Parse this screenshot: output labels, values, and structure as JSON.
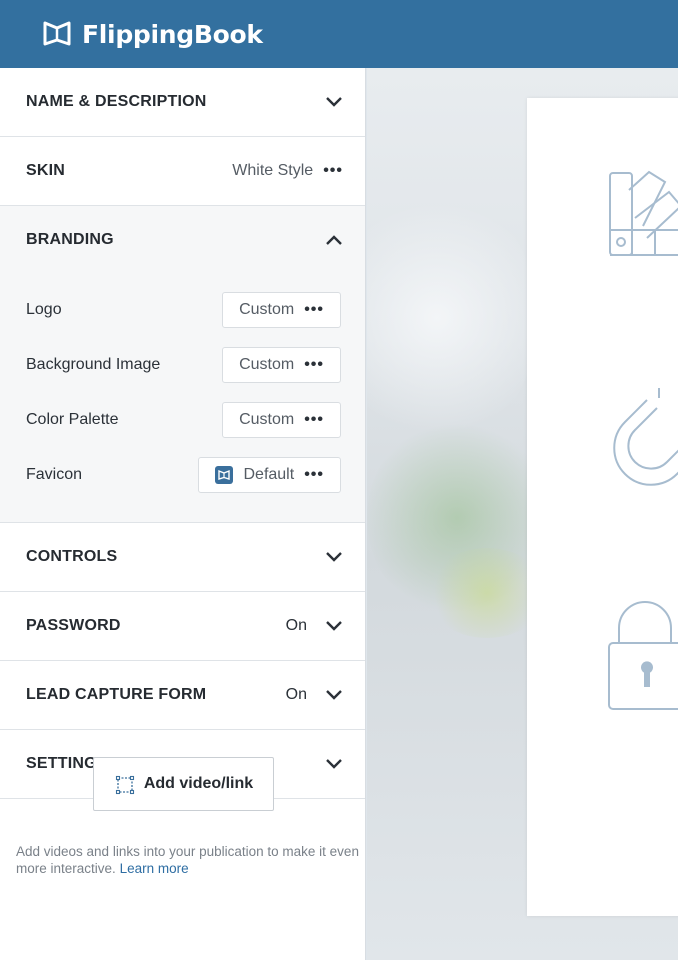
{
  "header": {
    "brand": "FlippingBook"
  },
  "sections": {
    "name_desc": {
      "title": "NAME & DESCRIPTION"
    },
    "skin": {
      "title": "SKIN",
      "value": "White Style"
    },
    "branding": {
      "title": "BRANDING",
      "rows": [
        {
          "label": "Logo",
          "value": "Custom"
        },
        {
          "label": "Background Image",
          "value": "Custom"
        },
        {
          "label": "Color Palette",
          "value": "Custom"
        },
        {
          "label": "Favicon",
          "value": "Default"
        }
      ]
    },
    "controls": {
      "title": "CONTROLS"
    },
    "password": {
      "title": "PASSWORD",
      "value": "On"
    },
    "lead": {
      "title": "LEAD CAPTURE FORM",
      "value": "On"
    },
    "settings": {
      "title": "SETTINGS"
    }
  },
  "bottom": {
    "add_label": "Add video/link",
    "help_text": "Add videos and links into your publication to make it even more interactive.",
    "learn_more": "Learn more"
  },
  "colors": {
    "header_bg": "#33709f",
    "accent": "#2f6ea3"
  },
  "icons": [
    "book-logo-icon",
    "chevron-down-icon",
    "chevron-up-icon",
    "more-dots-icon",
    "favicon-icon",
    "add-link-icon",
    "palette-icon",
    "magnet-icon",
    "lock-icon"
  ]
}
